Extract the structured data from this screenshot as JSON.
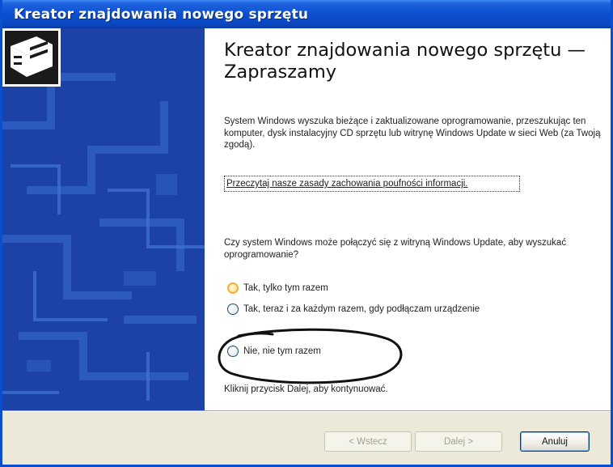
{
  "window": {
    "title": "Kreator znajdowania nowego sprzętu"
  },
  "heading": "Kreator znajdowania nowego sprzętu — Zapraszamy",
  "intro": "System Windows wyszuka bieżące i zaktualizowane oprogramowanie, przeszukując ten komputer, dysk instalacyjny CD sprzętu lub witrynę Windows Update w sieci Web (za Twoją zgodą).",
  "privacy_link": "Przeczytaj nasze zasady zachowania poufności informacji.",
  "question": "Czy system Windows może połączyć się z witryną Windows Update, aby wyszukać oprogramowanie?",
  "options": [
    {
      "label": "Tak, tylko tym razem",
      "selected": false
    },
    {
      "label": "Tak, teraz i za każdym razem, gdy podłączam urządzenie",
      "selected": false
    },
    {
      "label": "Nie, nie tym razem",
      "selected": false
    }
  ],
  "hint": "Kliknij przycisk Dalej, aby kontynuować.",
  "buttons": {
    "back": "< Wstecz",
    "next": "Dalej >",
    "cancel": "Anuluj"
  },
  "colors": {
    "titlebar": "#0a4fd0",
    "sidepanel": "#1c42a8",
    "dialog_bg": "#ece9d8",
    "radio_hover": "#f3b13a"
  },
  "icons": {
    "hardware": "hardware-wizard-icon",
    "annotation": "hand-drawn-circle"
  }
}
